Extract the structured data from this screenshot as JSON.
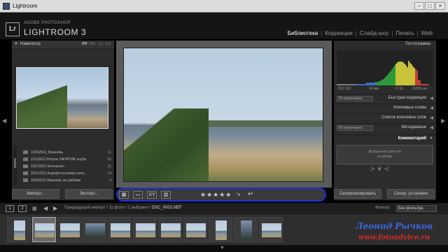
{
  "window": {
    "title": "Lightroom"
  },
  "identity": {
    "logo": "Lr",
    "adobe": "ADOBE PHOTOSHOP",
    "product": "LIGHTROOM 3"
  },
  "modules": [
    "Библиотека",
    "Коррекции",
    "Слайд-шоу",
    "Печать",
    "Web"
  ],
  "navigator": {
    "title": "Навигатор",
    "zoom_fit": "FIT",
    "zoom_fill": "FILL",
    "zoom_1": "1:1",
    "zoom_2": "1:4"
  },
  "folders": [
    {
      "name": "12042012_Вишнёвь",
      "count": "11"
    },
    {
      "name": "12112011 Второе ЗАНЯТИЕ клуба",
      "count": "55"
    },
    {
      "name": "13072012 Котельнич",
      "count": "11"
    },
    {
      "name": "15012012 Аэрофотосъемка села...",
      "count": "14"
    },
    {
      "name": "15092011 Вишнёвь за грибами",
      "count": "4"
    }
  ],
  "left_buttons": {
    "import": "Импорт...",
    "export": "Экспорт..."
  },
  "toolbar": {
    "stars": "★★★★★",
    "undo": "⤷",
    "redo": "↵"
  },
  "histogram": {
    "title": "Гистограмма",
    "iso": "ISO 100",
    "focal": "34 мм",
    "aperture": "f / 11",
    "shutter": "1/250 сек"
  },
  "right_panel": {
    "quick_develop": "Быстрая коррекция",
    "keywords": "Ключевые слова",
    "keyword_list": "Список ключевых слов",
    "metadata": "Метаданные",
    "comments": "Комментарий",
    "preset_default": "По умолчанию",
    "preset_default_2": "По умолчанию",
    "comment_text_1": "Выбранное фото не",
    "comment_text_2": "в наборе"
  },
  "right_buttons": {
    "sync_meta": "Синхронизировать",
    "sync_settings": "Синхр. установки"
  },
  "filmbar": {
    "page1": "1",
    "page2": "2",
    "grid": "▦",
    "arrow_left": "◀",
    "arrow_right": "▶",
    "crumb_prefix": "Предыдущий импорт / 11 фото / 1 выбрано /",
    "crumb_file": "DSC_0002.NEF",
    "filter_label": "Фильтр:",
    "filter_value": "Без фильтра"
  },
  "watermark": {
    "line1": "Леонид Рычков",
    "line2": "www.fotoadvice.ru"
  },
  "colors": {
    "annotation": "#1e2fd6",
    "watermark_blue": "#3a66e6",
    "watermark_red": "#d42a2a"
  }
}
